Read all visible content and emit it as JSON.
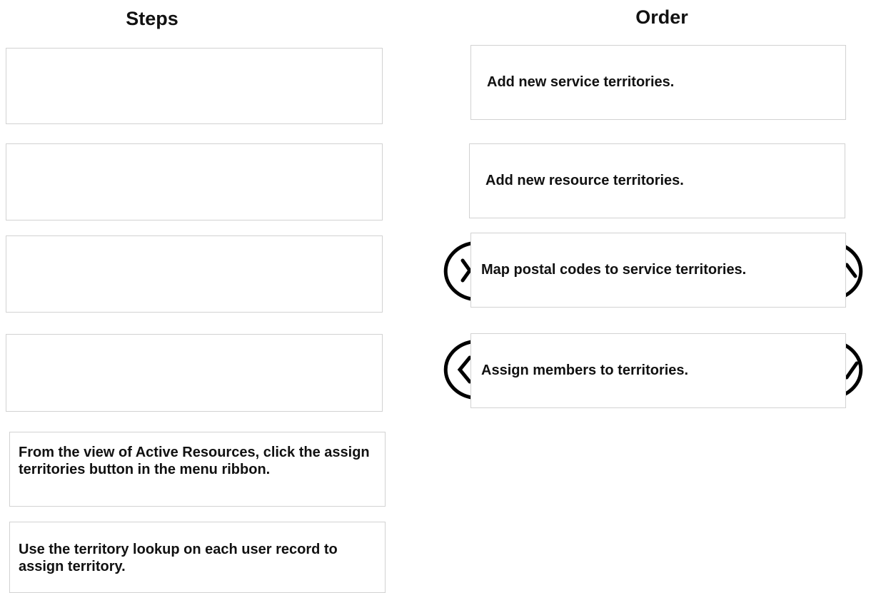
{
  "headings": {
    "steps": "Steps",
    "order": "Order"
  },
  "order_items": [
    {
      "label": "Add new service territories."
    },
    {
      "label": "Add new resource territories."
    },
    {
      "label": "Map postal codes to service territories."
    },
    {
      "label": "Assign members to territories."
    }
  ],
  "step_options": [
    {
      "label": "From the view of Active Resources, click the assign territories button in the menu ribbon."
    },
    {
      "label": "Use the territory lookup on each user record to assign territory."
    }
  ],
  "controls": {
    "left_arrow_icon": "chevron-left-icon",
    "right_arrow_icon": "chevron-right-icon",
    "arrow_color": "#000000"
  }
}
